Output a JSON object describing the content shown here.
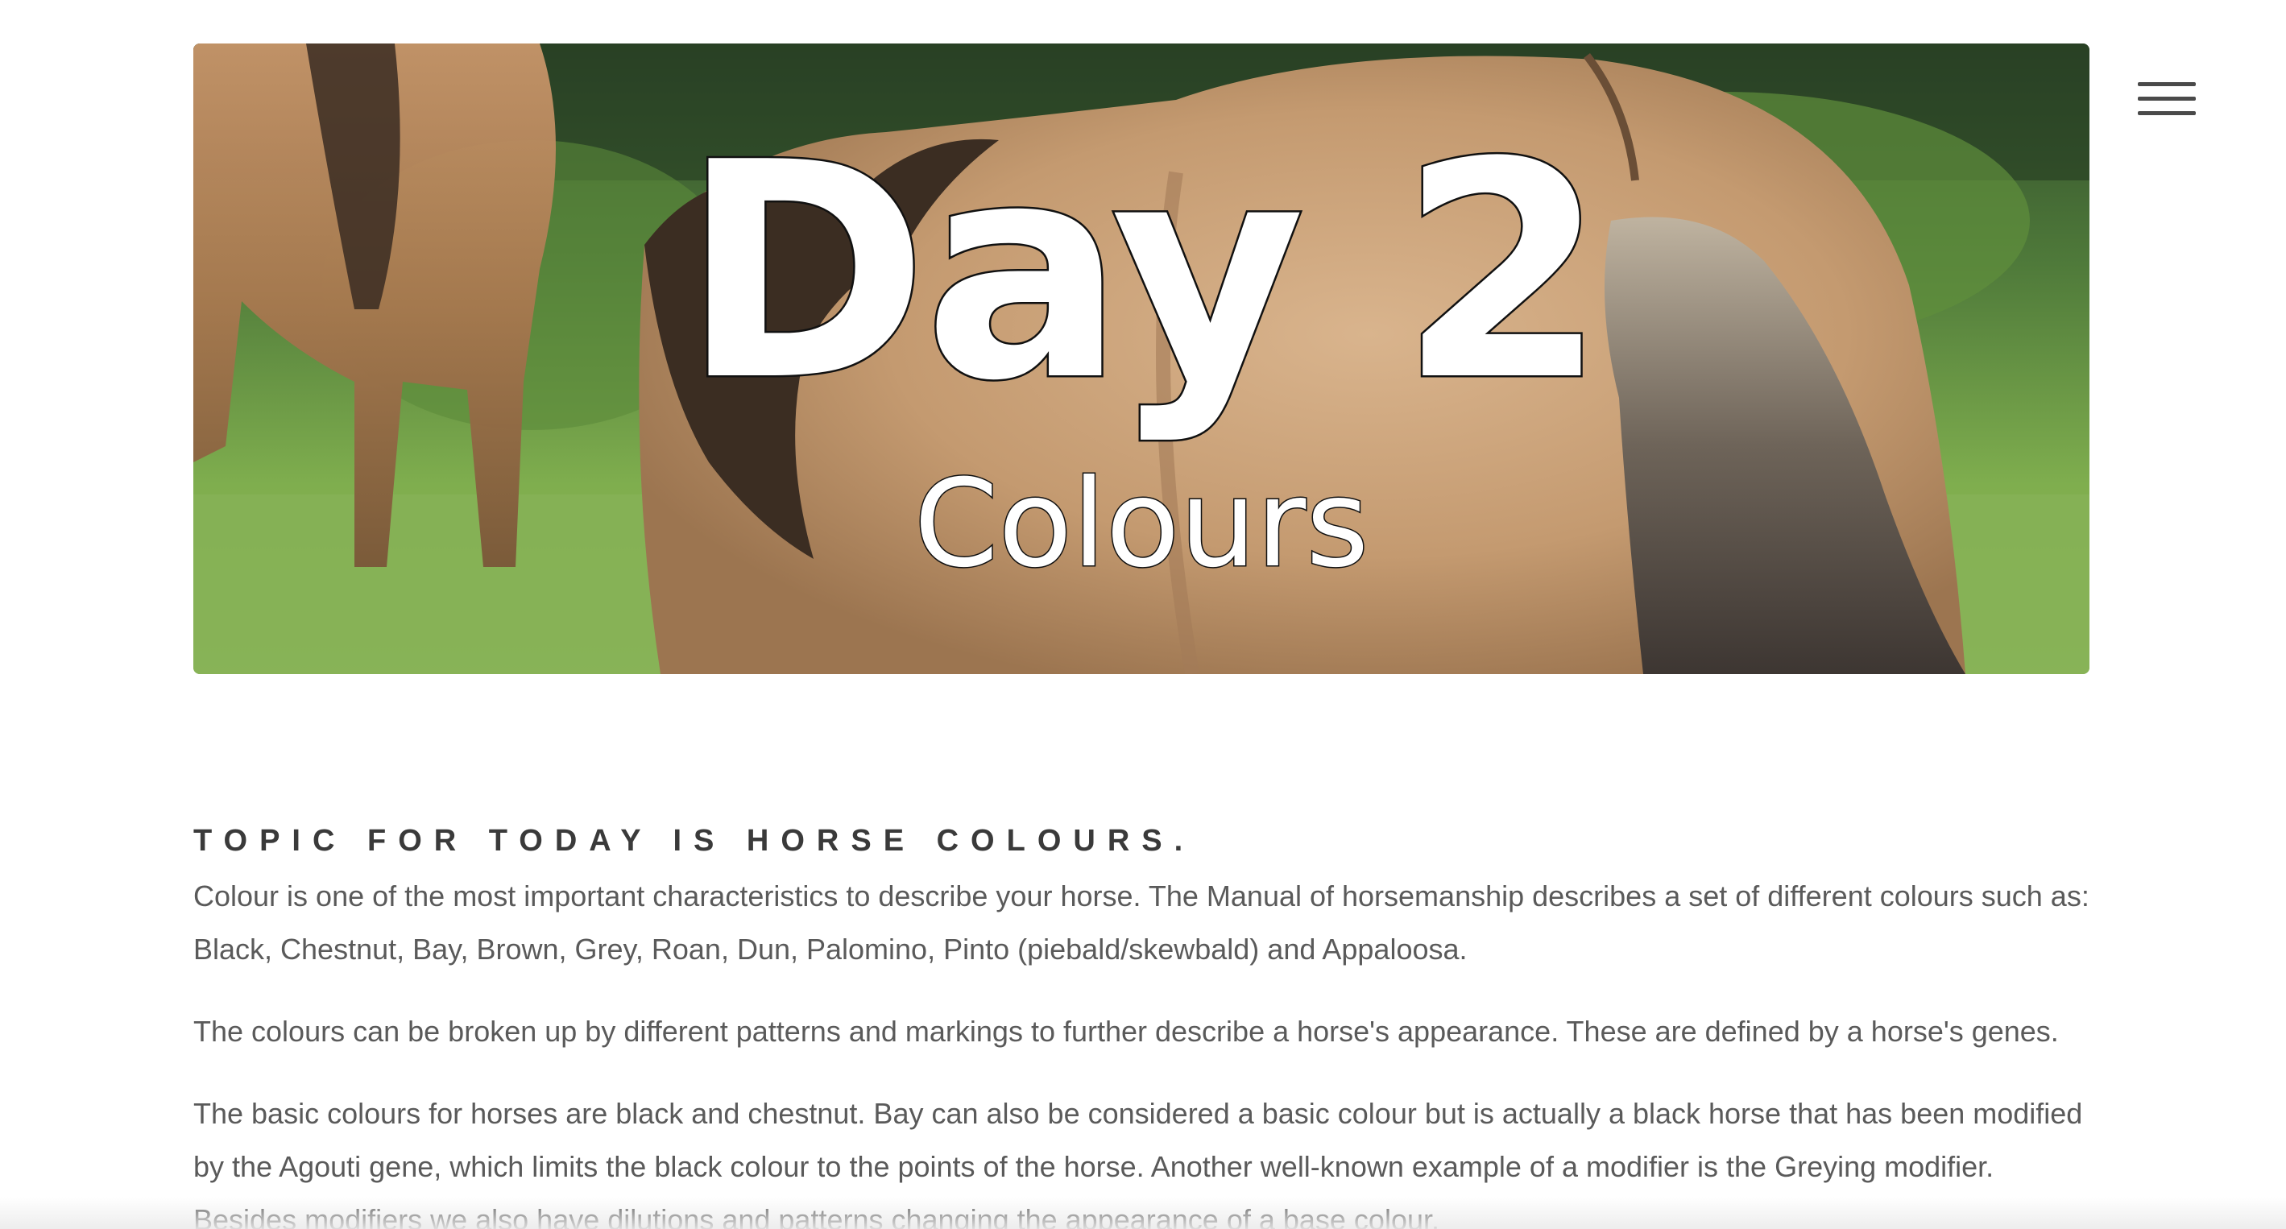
{
  "hero": {
    "title": "Day 2",
    "subtitle": "Colours",
    "image_description_icon": "horse-photo"
  },
  "menu": {
    "icon": "hamburger-menu-icon"
  },
  "content": {
    "heading": "Topic for today is horse colours.",
    "paragraphs": [
      "Colour is one of the most important characteristics to describe your horse. The Manual of horsemanship describes a set of different colours such as: Black, Chestnut, Bay, Brown, Grey, Roan, Dun, Palomino, Pinto (piebald/skewbald) and Appaloosa.",
      "The colours can be broken up by different patterns and markings to further describe a horse's appearance. These are defined by a horse's genes.",
      "The basic colours for horses are black and chestnut. Bay can also be considered a basic colour but is actually a black horse that has been modified by the Agouti gene, which limits the black colour to the points of the horse. Another well-known example of a modifier is the Greying modifier. Besides modifiers we also have dilutions and patterns changing the appearance of a base colour."
    ]
  },
  "colors": {
    "text": "#5a5a5a",
    "heading": "#3a3a3a",
    "menu_bar": "#4a4a4a"
  }
}
